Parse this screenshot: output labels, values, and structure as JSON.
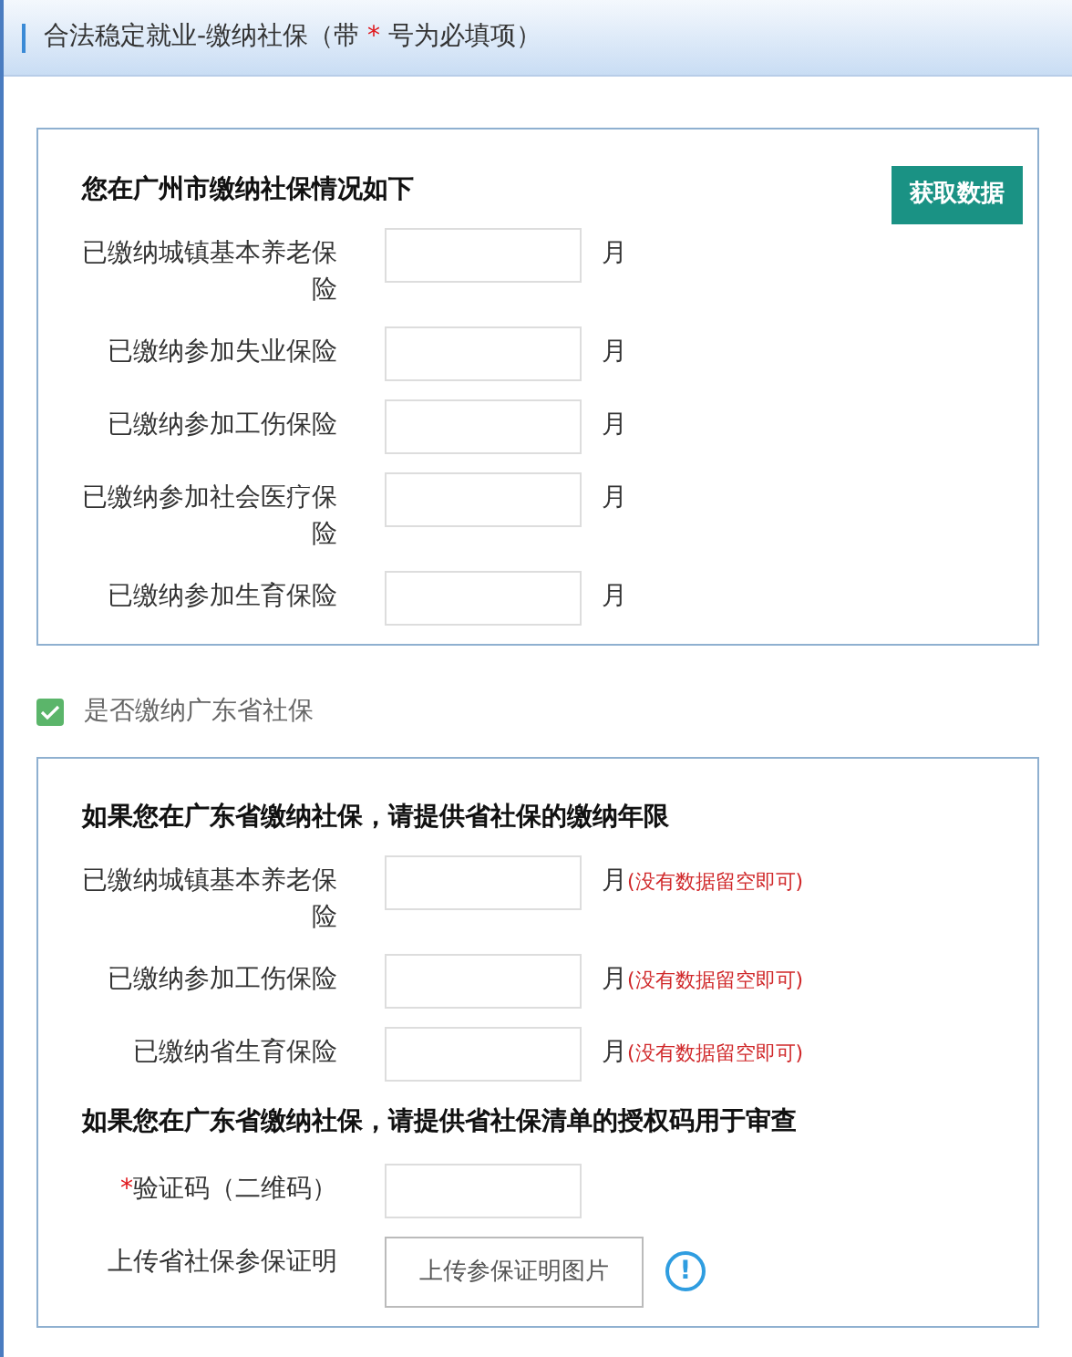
{
  "header": {
    "title_before": "合法稳定就业-缴纳社保（带 ",
    "required_mark": "*",
    "title_after": " 号为必填项）"
  },
  "city_panel": {
    "title": "您在广州市缴纳社保情况如下",
    "fetch_button": "获取数据",
    "fields": [
      {
        "kind": "number",
        "label": "已缴纳城镇基本养老保险",
        "unit": "月"
      },
      {
        "kind": "number",
        "label": "已缴纳参加失业保险",
        "unit": "月"
      },
      {
        "kind": "number",
        "label": "已缴纳参加工伤保险",
        "unit": "月"
      },
      {
        "kind": "number",
        "label": "已缴纳参加社会医疗保险",
        "unit": "月"
      },
      {
        "kind": "number",
        "label": "已缴纳参加生育保险",
        "unit": "月"
      }
    ]
  },
  "province_checkbox": {
    "label": "是否缴纳广东省社保",
    "checked": true
  },
  "province_panel": {
    "title": "如果您在广东省缴纳社保，请提供省社保的缴纳年限",
    "fields": [
      {
        "kind": "number",
        "label": "已缴纳城镇基本养老保险",
        "unit": "月",
        "hint": "(没有数据留空即可)"
      },
      {
        "kind": "number",
        "label": "已缴纳参加工伤保险",
        "unit": "月",
        "hint": "(没有数据留空即可)"
      },
      {
        "kind": "number",
        "label": "已缴纳省生育保险",
        "unit": "月",
        "hint": "(没有数据留空即可)"
      }
    ],
    "auth_title": "如果您在广东省缴纳社保，请提供省社保清单的授权码用于审查",
    "auth_fields": [
      {
        "kind": "text",
        "label": "验证码（二维码）",
        "required_mark": "*"
      },
      {
        "kind": "upload",
        "label": "上传省社保参保证明",
        "button": "上传参保证明图片",
        "info": "!"
      }
    ]
  }
}
